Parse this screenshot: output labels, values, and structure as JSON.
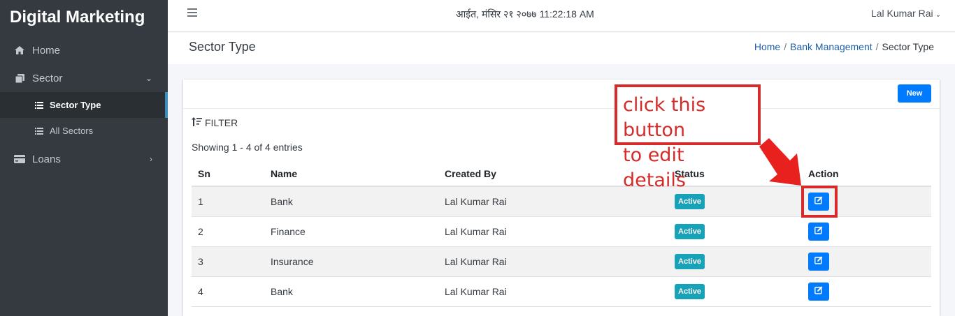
{
  "app": {
    "brand": "Digital Marketing"
  },
  "sidebar": {
    "items": [
      {
        "label": "Home",
        "icon": "home-icon"
      },
      {
        "label": "Sector",
        "icon": "copy-icon",
        "expanded": true,
        "children": [
          {
            "label": "Sector Type",
            "icon": "list-icon",
            "active": true
          },
          {
            "label": "All Sectors",
            "icon": "list-icon"
          }
        ]
      },
      {
        "label": "Loans",
        "icon": "credit-card-icon"
      }
    ]
  },
  "topbar": {
    "datetime": "आईत, मंसिर २१ २०७७ 11:22:18 AM",
    "user": "Lal Kumar Rai"
  },
  "header": {
    "title": "Sector Type",
    "breadcrumb": [
      "Home",
      "Bank Management",
      "Sector Type"
    ]
  },
  "card": {
    "new_button": "New",
    "filter_label": "FILTER",
    "showing": "Showing 1 - 4 of 4 entries",
    "columns": [
      "Sn",
      "Name",
      "Created By",
      "Status",
      "Action"
    ],
    "rows": [
      {
        "sn": "1",
        "name": "Bank",
        "created_by": "Lal Kumar Rai",
        "status": "Active"
      },
      {
        "sn": "2",
        "name": "Finance",
        "created_by": "Lal Kumar Rai",
        "status": "Active"
      },
      {
        "sn": "3",
        "name": "Insurance",
        "created_by": "Lal Kumar Rai",
        "status": "Active"
      },
      {
        "sn": "4",
        "name": "Bank",
        "created_by": "Lal Kumar Rai",
        "status": "Active"
      }
    ]
  },
  "annotation": {
    "line1": "click this button",
    "line2": "to edit details",
    "color": "#d62b2b"
  },
  "colors": {
    "primary": "#007bff",
    "status_active": "#17a2b8",
    "sidebar_bg": "#343a40"
  }
}
